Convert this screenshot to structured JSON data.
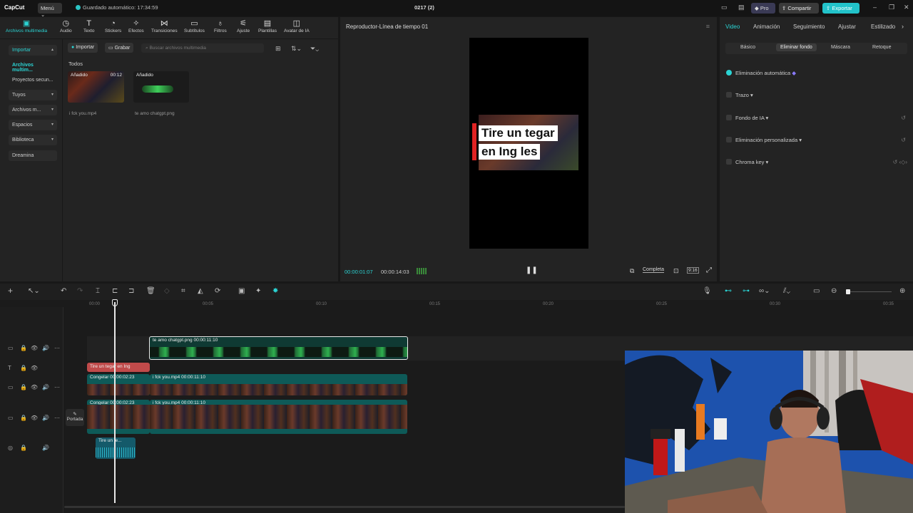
{
  "titlebar": {
    "app": "CapCut",
    "menu": "Menú",
    "autosave": "Guardado automático: 17:34:59",
    "project": "0217 (2)",
    "pro": "Pro",
    "share": "Compartir",
    "export": "Exportar"
  },
  "media_tools": [
    {
      "label": "Archivos multimedia",
      "icon": "media-icon"
    },
    {
      "label": "Audio",
      "icon": "audio-icon"
    },
    {
      "label": "Texto",
      "icon": "text-icon"
    },
    {
      "label": "Stickers",
      "icon": "stickers-icon"
    },
    {
      "label": "Efectos",
      "icon": "effects-icon"
    },
    {
      "label": "Transiciones",
      "icon": "transitions-icon"
    },
    {
      "label": "Subtítulos",
      "icon": "subtitles-icon"
    },
    {
      "label": "Filtros",
      "icon": "filters-icon"
    },
    {
      "label": "Ajuste",
      "icon": "adjust-icon"
    },
    {
      "label": "Plantillas",
      "icon": "templates-icon"
    },
    {
      "label": "Avatar de IA",
      "icon": "ai-avatar-icon"
    }
  ],
  "media_sidebar": [
    {
      "label": "Importar"
    },
    {
      "label": "Archivos multim..."
    },
    {
      "label": "Proyectos secun..."
    },
    {
      "label": "Tuyos"
    },
    {
      "label": "Archivos m..."
    },
    {
      "label": "Espacios"
    },
    {
      "label": "Biblioteca"
    },
    {
      "label": "Dreamina"
    }
  ],
  "media_main": {
    "import_btn": "Importar",
    "record_btn": "Grabar",
    "search_placeholder": "Buscar archivos multimedia",
    "filter_label": "Todos",
    "items": [
      {
        "tag": "Añadido",
        "duration": "00:12",
        "name": "i fck you.mp4"
      },
      {
        "tag": "Añadido",
        "duration": "",
        "name": "te amo chatgpt.png"
      }
    ]
  },
  "player": {
    "title": "Reproductor-Línea de tiempo 01",
    "caption_line1": "Tire un tegar",
    "caption_line2": "en Ing les",
    "current_time": "00:00:01:07",
    "total_time": "00:00:14:03",
    "view_mode": "Completa",
    "aspect": "9:16"
  },
  "properties": {
    "tabs": [
      "Video",
      "Animación",
      "Seguimiento",
      "Ajustar",
      "Estilizado"
    ],
    "subtabs": [
      "Básico",
      "Eliminar fondo",
      "Máscara",
      "Retoque"
    ],
    "options": [
      {
        "label": "Eliminación automática",
        "checked": true
      },
      {
        "label": "Trazo",
        "checked": false
      },
      {
        "label": "Fondo de IA",
        "checked": false
      },
      {
        "label": "Eliminación personalizada",
        "checked": false
      },
      {
        "label": "Chroma key",
        "checked": false
      }
    ]
  },
  "timeline": {
    "ruler": [
      "00:00",
      "00:05",
      "00:10",
      "00:15",
      "00:20",
      "00:25",
      "00:30",
      "00:35"
    ],
    "cover_label": "Portada",
    "clips": {
      "image_clip": "te amo chatgpt.png  00:00:11:10",
      "text_clip": "Tire un tegar en Ing",
      "v1_freeze": "Congelar  00:00:02:23",
      "v1_main": "i fck you.mp4   00:00:11:10",
      "v2_freeze": "Congelar  00:00:02:23",
      "v2_main": "i fck you.mp4   00:00:11:10",
      "audio_clip": "Tire un te..."
    }
  }
}
